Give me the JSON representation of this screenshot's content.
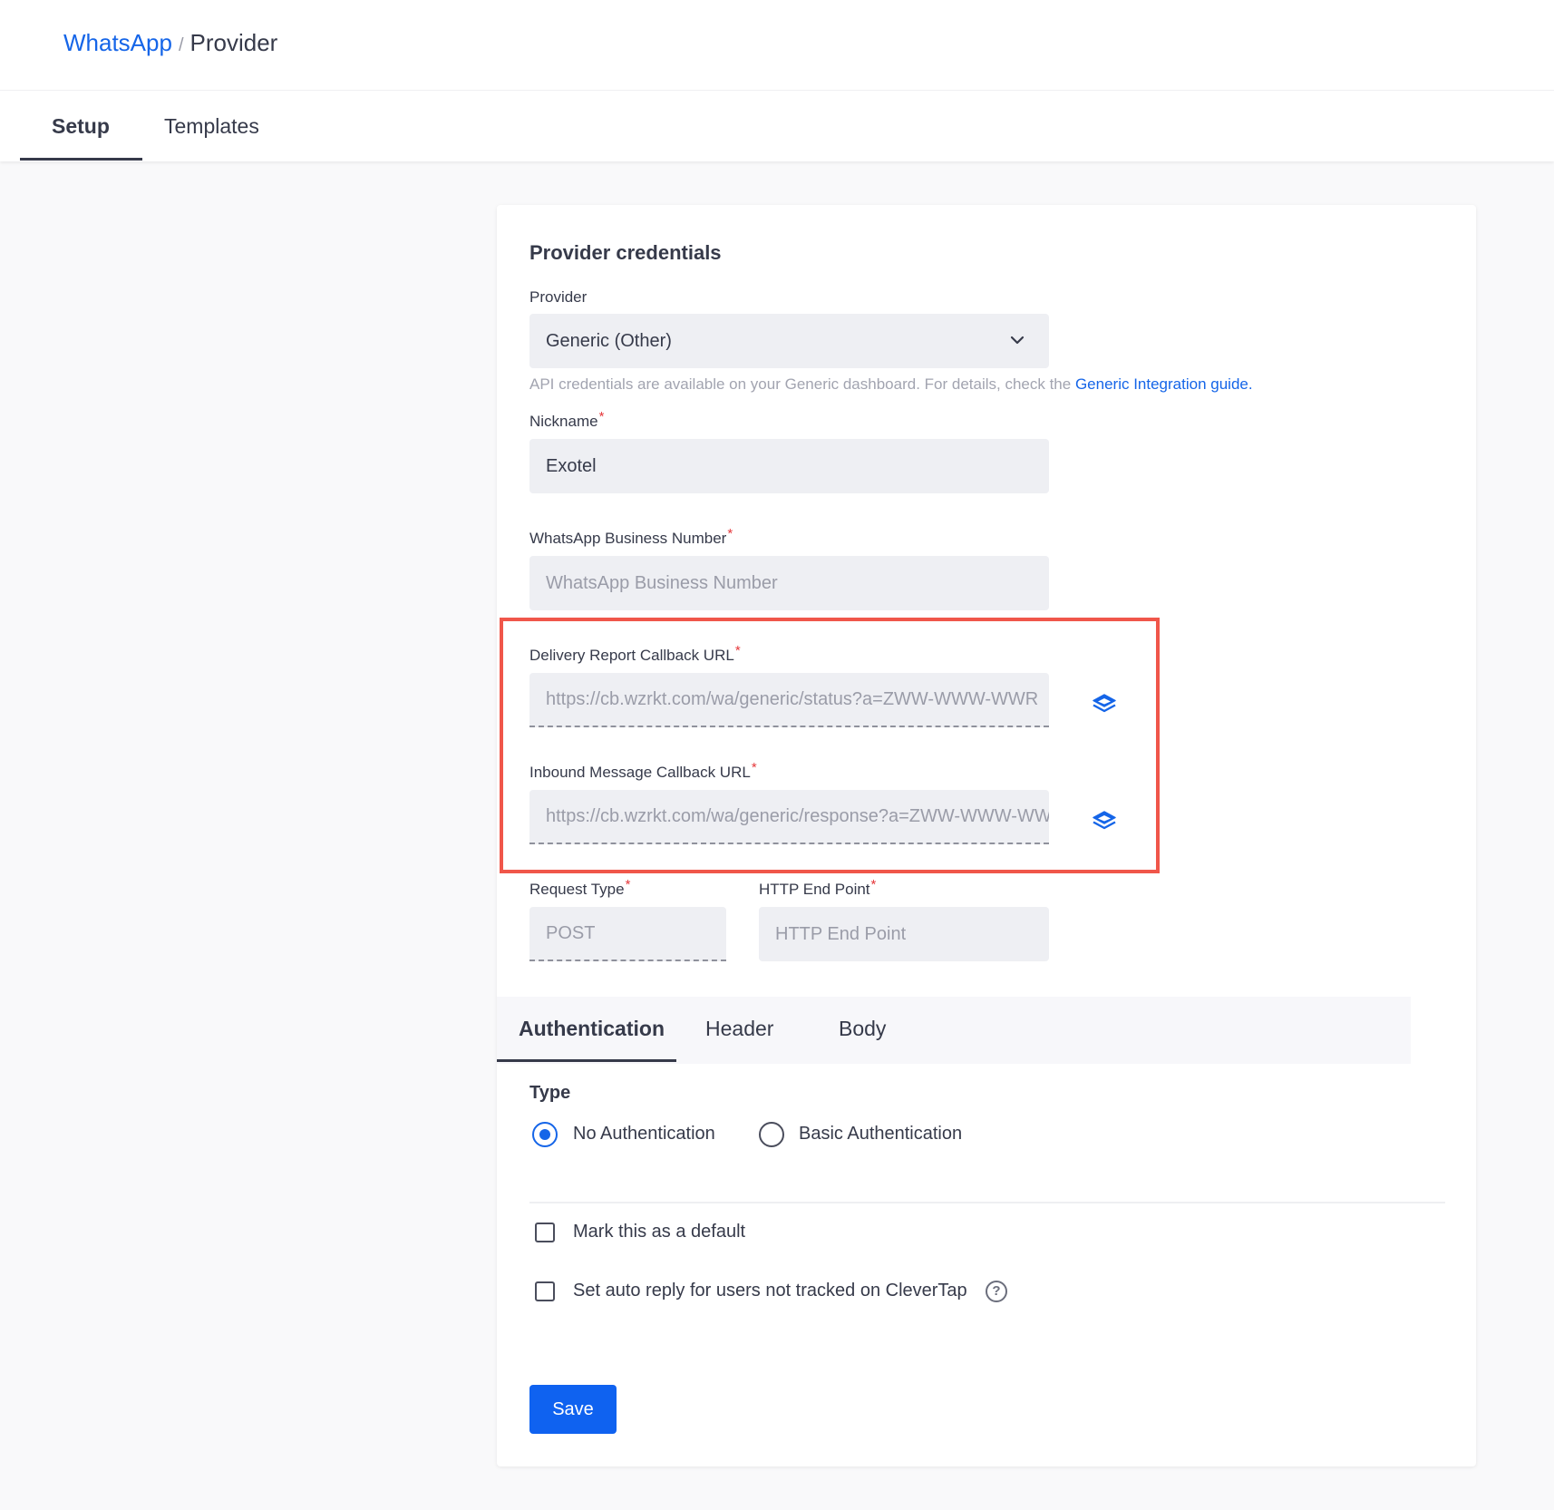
{
  "breadcrumb": {
    "parent": "WhatsApp",
    "separator": "/",
    "current": "Provider"
  },
  "tabs": [
    {
      "label": "Setup",
      "active": true
    },
    {
      "label": "Templates",
      "active": false
    }
  ],
  "card": {
    "title": "Provider credentials",
    "provider": {
      "label": "Provider",
      "value": "Generic (Other)"
    },
    "helper": {
      "text": "API credentials are available on your Generic dashboard. For details, check the ",
      "link": "Generic Integration guide."
    },
    "nickname": {
      "label": "Nickname",
      "required": "*",
      "value": "Exotel"
    },
    "business_number": {
      "label": "WhatsApp Business Number",
      "required": "*",
      "placeholder": "WhatsApp Business Number"
    },
    "delivery_url": {
      "label": "Delivery Report Callback URL",
      "required": "*",
      "value": "https://cb.wzrkt.com/wa/generic/status?a=ZWW-WWW-WWR"
    },
    "inbound_url": {
      "label": "Inbound Message Callback URL",
      "required": "*",
      "value": "https://cb.wzrkt.com/wa/generic/response?a=ZWW-WWW-WWR"
    },
    "request_type": {
      "label": "Request Type",
      "required": "*",
      "value": "POST"
    },
    "http_endpoint": {
      "label": "HTTP End Point",
      "required": "*",
      "placeholder": "HTTP End Point"
    },
    "subtabs": [
      {
        "label": "Authentication",
        "active": true
      },
      {
        "label": "Header",
        "active": false
      },
      {
        "label": "Body",
        "active": false
      }
    ],
    "auth": {
      "type_label": "Type",
      "options": [
        {
          "label": "No Authentication",
          "checked": true
        },
        {
          "label": "Basic Authentication",
          "checked": false
        }
      ]
    },
    "checkboxes": [
      {
        "label": "Mark this as a default",
        "checked": false
      },
      {
        "label": "Set auto reply for users not tracked on CleverTap",
        "checked": false
      }
    ],
    "help_glyph": "?",
    "save_label": "Save"
  },
  "colors": {
    "accent": "#1565e8",
    "required": "#e5383b",
    "highlight": "#f0564a",
    "button": "#0f62f0"
  },
  "icons": {
    "chevron": "chevron-down-icon",
    "copy": "copy-icon",
    "help": "help-circle-icon"
  }
}
